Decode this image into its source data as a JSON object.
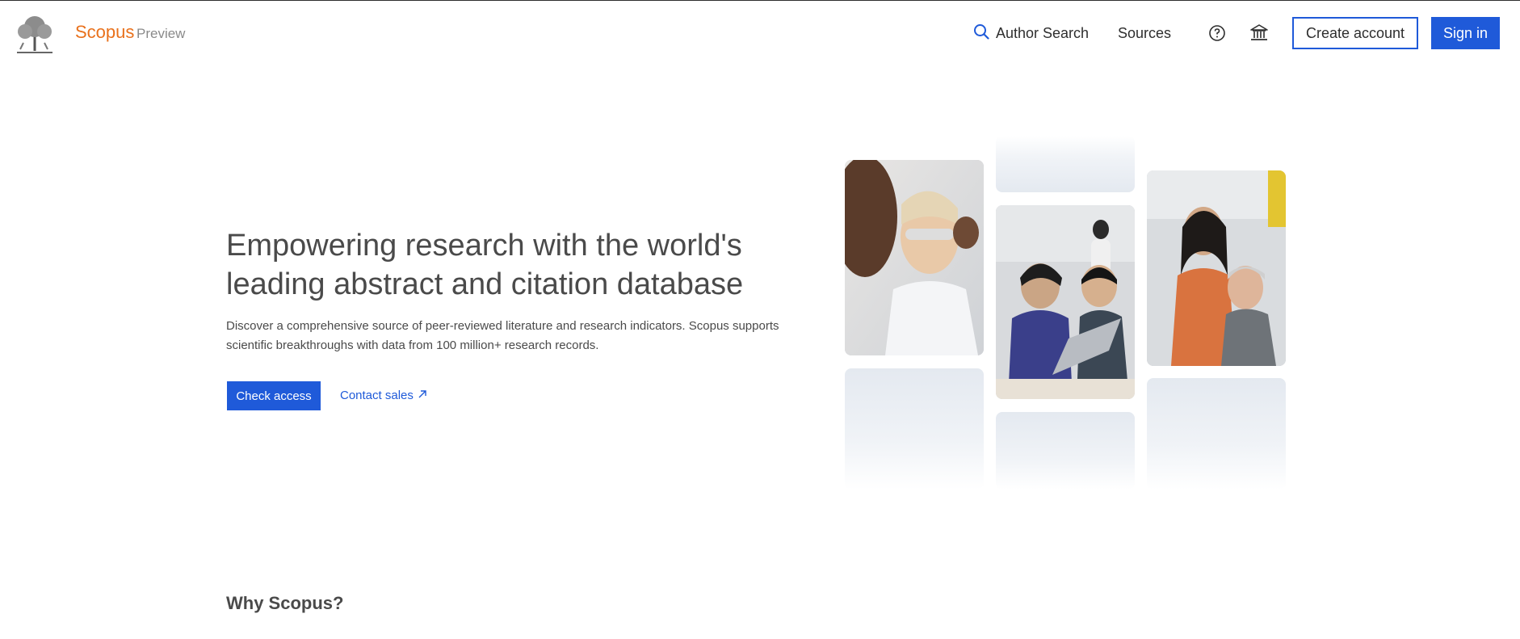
{
  "header": {
    "brand": "Scopus",
    "brand_sub": "Preview",
    "nav": {
      "author_search": "Author Search",
      "sources": "Sources"
    },
    "create_account": "Create account",
    "sign_in": "Sign in"
  },
  "hero": {
    "title": "Empowering research with the world's leading abstract and citation database",
    "description": "Discover a comprehensive source of peer-reviewed literature and research indicators. Scopus supports scientific breakthroughs with data from 100 million+ research records.",
    "check_access": "Check access",
    "contact_sales": "Contact sales"
  },
  "section": {
    "why_title": "Why Scopus?"
  },
  "icons": {
    "search": "search-icon",
    "help": "help-icon",
    "institution": "institution-icon",
    "external_link": "external-link-icon"
  },
  "colors": {
    "brand_orange": "#e9711c",
    "primary_blue": "#1f5ad9",
    "text": "#4a4a4a"
  }
}
